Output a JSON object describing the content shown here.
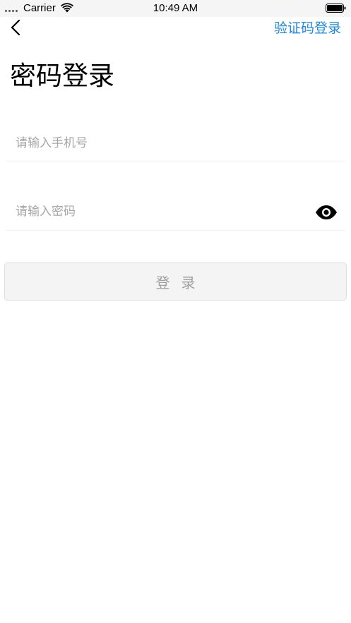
{
  "status_bar": {
    "carrier": "Carrier",
    "time": "10:49 AM",
    "wifi_icon": "wifi-icon",
    "battery_icon": "battery-icon"
  },
  "nav": {
    "back_icon": "chevron-left-icon",
    "switch_label": "验证码登录"
  },
  "title": "密码登录",
  "form": {
    "phone_placeholder": "请输入手机号",
    "phone_value": "",
    "password_placeholder": "请输入密码",
    "password_value": "",
    "eye_icon": "eye-icon",
    "login_label": "登录"
  },
  "colors": {
    "accent": "#1e88e5",
    "button_bg": "#f4f4f4",
    "button_text": "#9e9e9e",
    "placeholder": "#a6a6a6",
    "status_bar_bg": "#f5f5f5"
  }
}
